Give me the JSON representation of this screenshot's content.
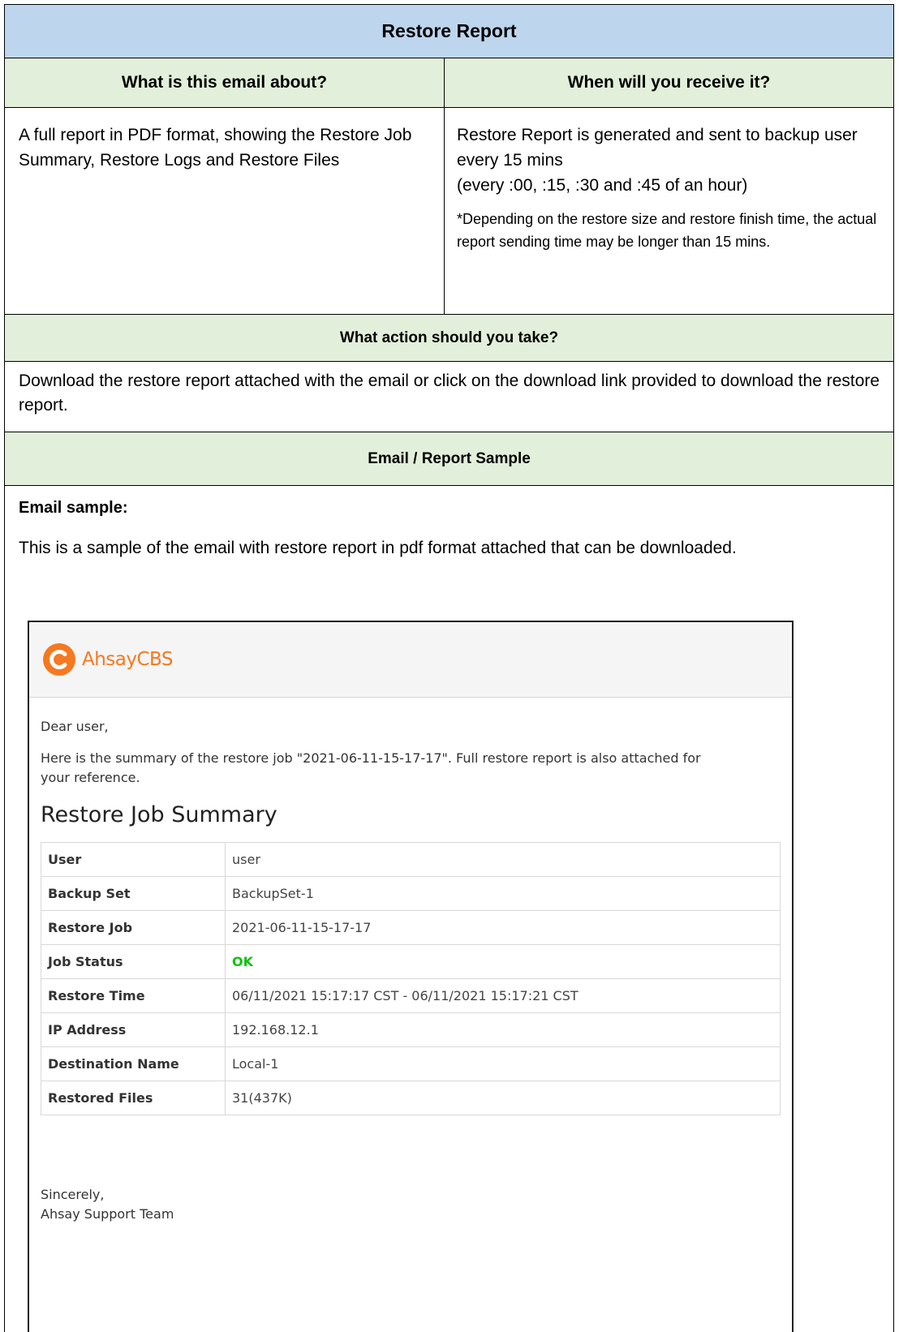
{
  "report": {
    "title": "Restore Report",
    "col_left_header": "What is this email about?",
    "col_right_header": "When will you receive it?",
    "about_text": "A full report in PDF format, showing the Restore Job Summary, Restore Logs and Restore Files",
    "when_line1": "Restore Report is generated and sent to backup user every 15 mins",
    "when_line2": "(every :00, :15, :30 and :45 of an hour)",
    "when_note": "*Depending on the restore size and restore finish time, the actual report sending time may be longer than 15 mins.",
    "action_header": "What action should you take?",
    "action_text": "Download the restore report attached with the email or click on the download link provided to download the restore report.",
    "sample_header": "Email / Report Sample",
    "sample_label": "Email sample:",
    "sample_desc": "This is a sample of the email with restore report in pdf format attached that can be downloaded."
  },
  "email": {
    "brand": "AhsayCBS",
    "brand_color": "#f47920",
    "greeting": "Dear user,",
    "intro": "Here is the summary of the restore job \"2021-06-11-15-17-17\". Full restore report is also attached for your reference.",
    "summary_title": "Restore Job Summary",
    "rows": [
      {
        "key": "User",
        "value": "user"
      },
      {
        "key": "Backup Set",
        "value": "BackupSet-1"
      },
      {
        "key": "Restore Job",
        "value": "2021-06-11-15-17-17"
      },
      {
        "key": "Job Status",
        "value": "OK"
      },
      {
        "key": "Restore Time",
        "value": "06/11/2021 15:17:17 CST - 06/11/2021 15:17:21 CST"
      },
      {
        "key": "IP Address",
        "value": "192.168.12.1"
      },
      {
        "key": "Destination Name",
        "value": "Local-1"
      },
      {
        "key": "Restored Files",
        "value": "31(437K)"
      }
    ],
    "status_color": "#12c012",
    "signoff_line1": "Sincerely,",
    "signoff_line2": "Ahsay Support Team"
  }
}
